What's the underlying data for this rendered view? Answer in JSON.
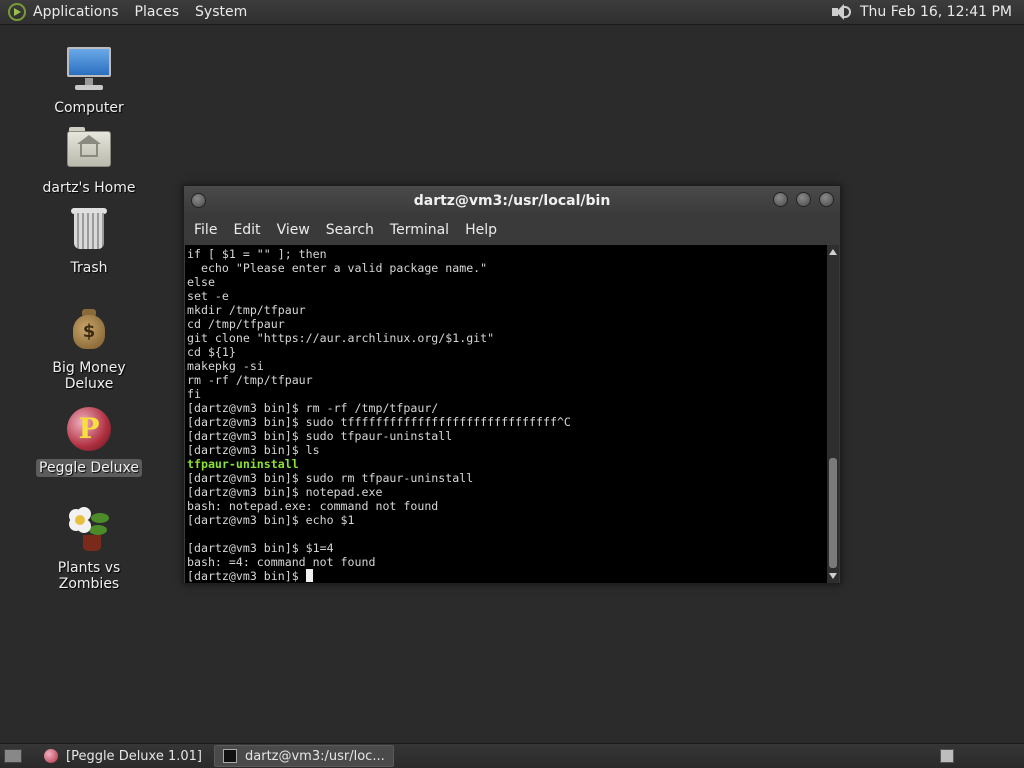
{
  "top_panel": {
    "menus": [
      "Applications",
      "Places",
      "System"
    ],
    "clock": "Thu Feb 16, 12:41 PM"
  },
  "desktop_icons": [
    {
      "label": "Computer",
      "icon": "computer-icon"
    },
    {
      "label": "dartz's Home",
      "icon": "home-folder-icon"
    },
    {
      "label": "Trash",
      "icon": "trash-icon"
    },
    {
      "label": "Big Money Deluxe",
      "icon": "money-bag-icon"
    },
    {
      "label": "Peggle Deluxe",
      "icon": "peggle-icon",
      "selected": true
    },
    {
      "label": "Plants vs Zombies",
      "icon": "plants-vs-zombies-icon"
    }
  ],
  "terminal": {
    "title": "dartz@vm3:/usr/local/bin",
    "menu": [
      "File",
      "Edit",
      "View",
      "Search",
      "Terminal",
      "Help"
    ],
    "lines": [
      {
        "text": "if [ $1 = \"\" ]; then"
      },
      {
        "text": "  echo \"Please enter a valid package name.\""
      },
      {
        "text": "else"
      },
      {
        "text": "set -e"
      },
      {
        "text": "mkdir /tmp/tfpaur"
      },
      {
        "text": "cd /tmp/tfpaur"
      },
      {
        "text": "git clone \"https://aur.archlinux.org/$1.git\""
      },
      {
        "text": "cd ${1}"
      },
      {
        "text": "makepkg -si"
      },
      {
        "text": "rm -rf /tmp/tfpaur"
      },
      {
        "text": "fi"
      },
      {
        "text": "[dartz@vm3 bin]$ rm -rf /tmp/tfpaur/"
      },
      {
        "text": "[dartz@vm3 bin]$ sudo tffffffffffffffffffffffffffffff^C"
      },
      {
        "text": "[dartz@vm3 bin]$ sudo tfpaur-uninstall"
      },
      {
        "text": "[dartz@vm3 bin]$ ls"
      },
      {
        "text": "tfpaur-uninstall",
        "color": "green"
      },
      {
        "text": "[dartz@vm3 bin]$ sudo rm tfpaur-uninstall"
      },
      {
        "text": "[dartz@vm3 bin]$ notepad.exe"
      },
      {
        "text": "bash: notepad.exe: command not found"
      },
      {
        "text": "[dartz@vm3 bin]$ echo $1"
      },
      {
        "text": ""
      },
      {
        "text": "[dartz@vm3 bin]$ $1=4"
      },
      {
        "text": "bash: =4: command not found"
      },
      {
        "text": "[dartz@vm3 bin]$ ",
        "cursor": true
      }
    ],
    "scroll_position": 0.97
  },
  "taskbar": {
    "tasks": [
      {
        "label": "[Peggle Deluxe 1.01]",
        "icon": "peggle-icon",
        "active": false
      },
      {
        "label": "dartz@vm3:/usr/loc...",
        "icon": "terminal-icon",
        "active": true
      }
    ]
  },
  "colors": {
    "desktop_bg": "#2b2b2b",
    "terminal_bg": "#000000",
    "terminal_fg": "#d6d6d6",
    "ls_executable": "#8ae234"
  }
}
